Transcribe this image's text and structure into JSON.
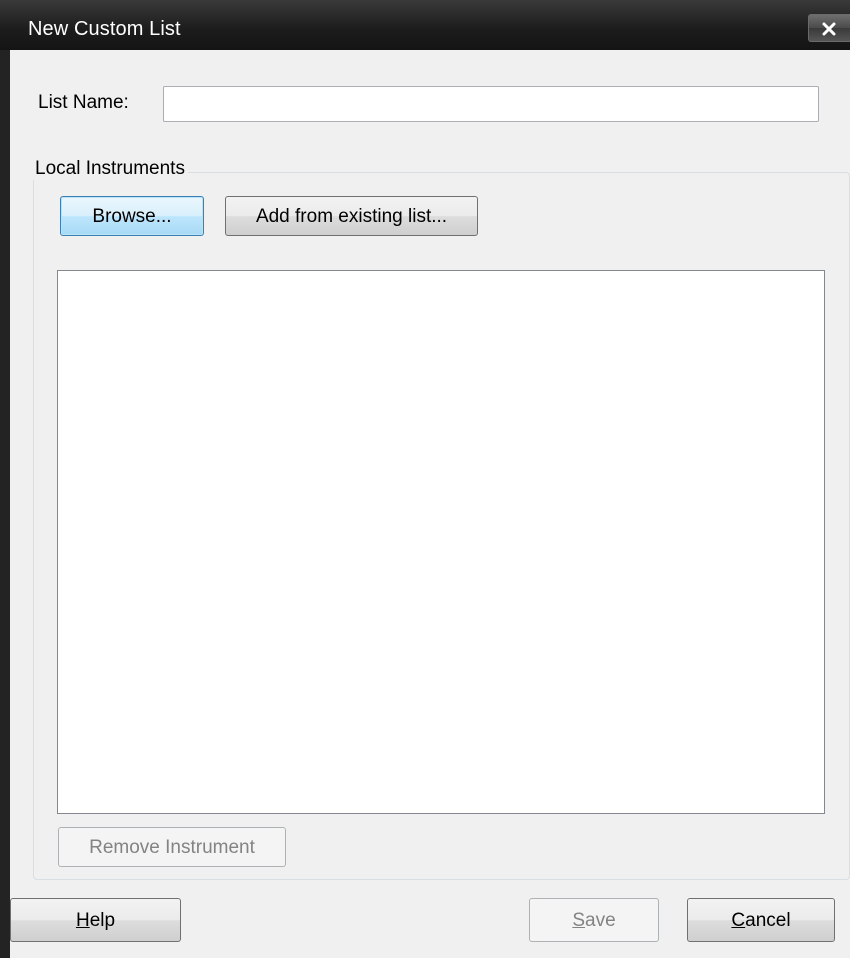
{
  "window": {
    "title": "New Custom List"
  },
  "list_name": {
    "label": "List Name:",
    "value": "",
    "placeholder": ""
  },
  "local_instruments": {
    "group_label": "Local Instruments",
    "browse_label": "Browse...",
    "add_existing_label": "Add from existing list...",
    "items": [],
    "remove_label": "Remove Instrument"
  },
  "footer": {
    "help_mnemonic": "H",
    "help_rest": "elp",
    "save_mnemonic": "S",
    "save_rest": "ave",
    "cancel_mnemonic": "C",
    "cancel_rest": "ancel"
  },
  "colors": {
    "titlebar": "#1c1c1c",
    "dialog_background": "#f0f0f0",
    "focused_button_border": "#3c7fb1"
  },
  "icons": {
    "close": "close-icon"
  }
}
